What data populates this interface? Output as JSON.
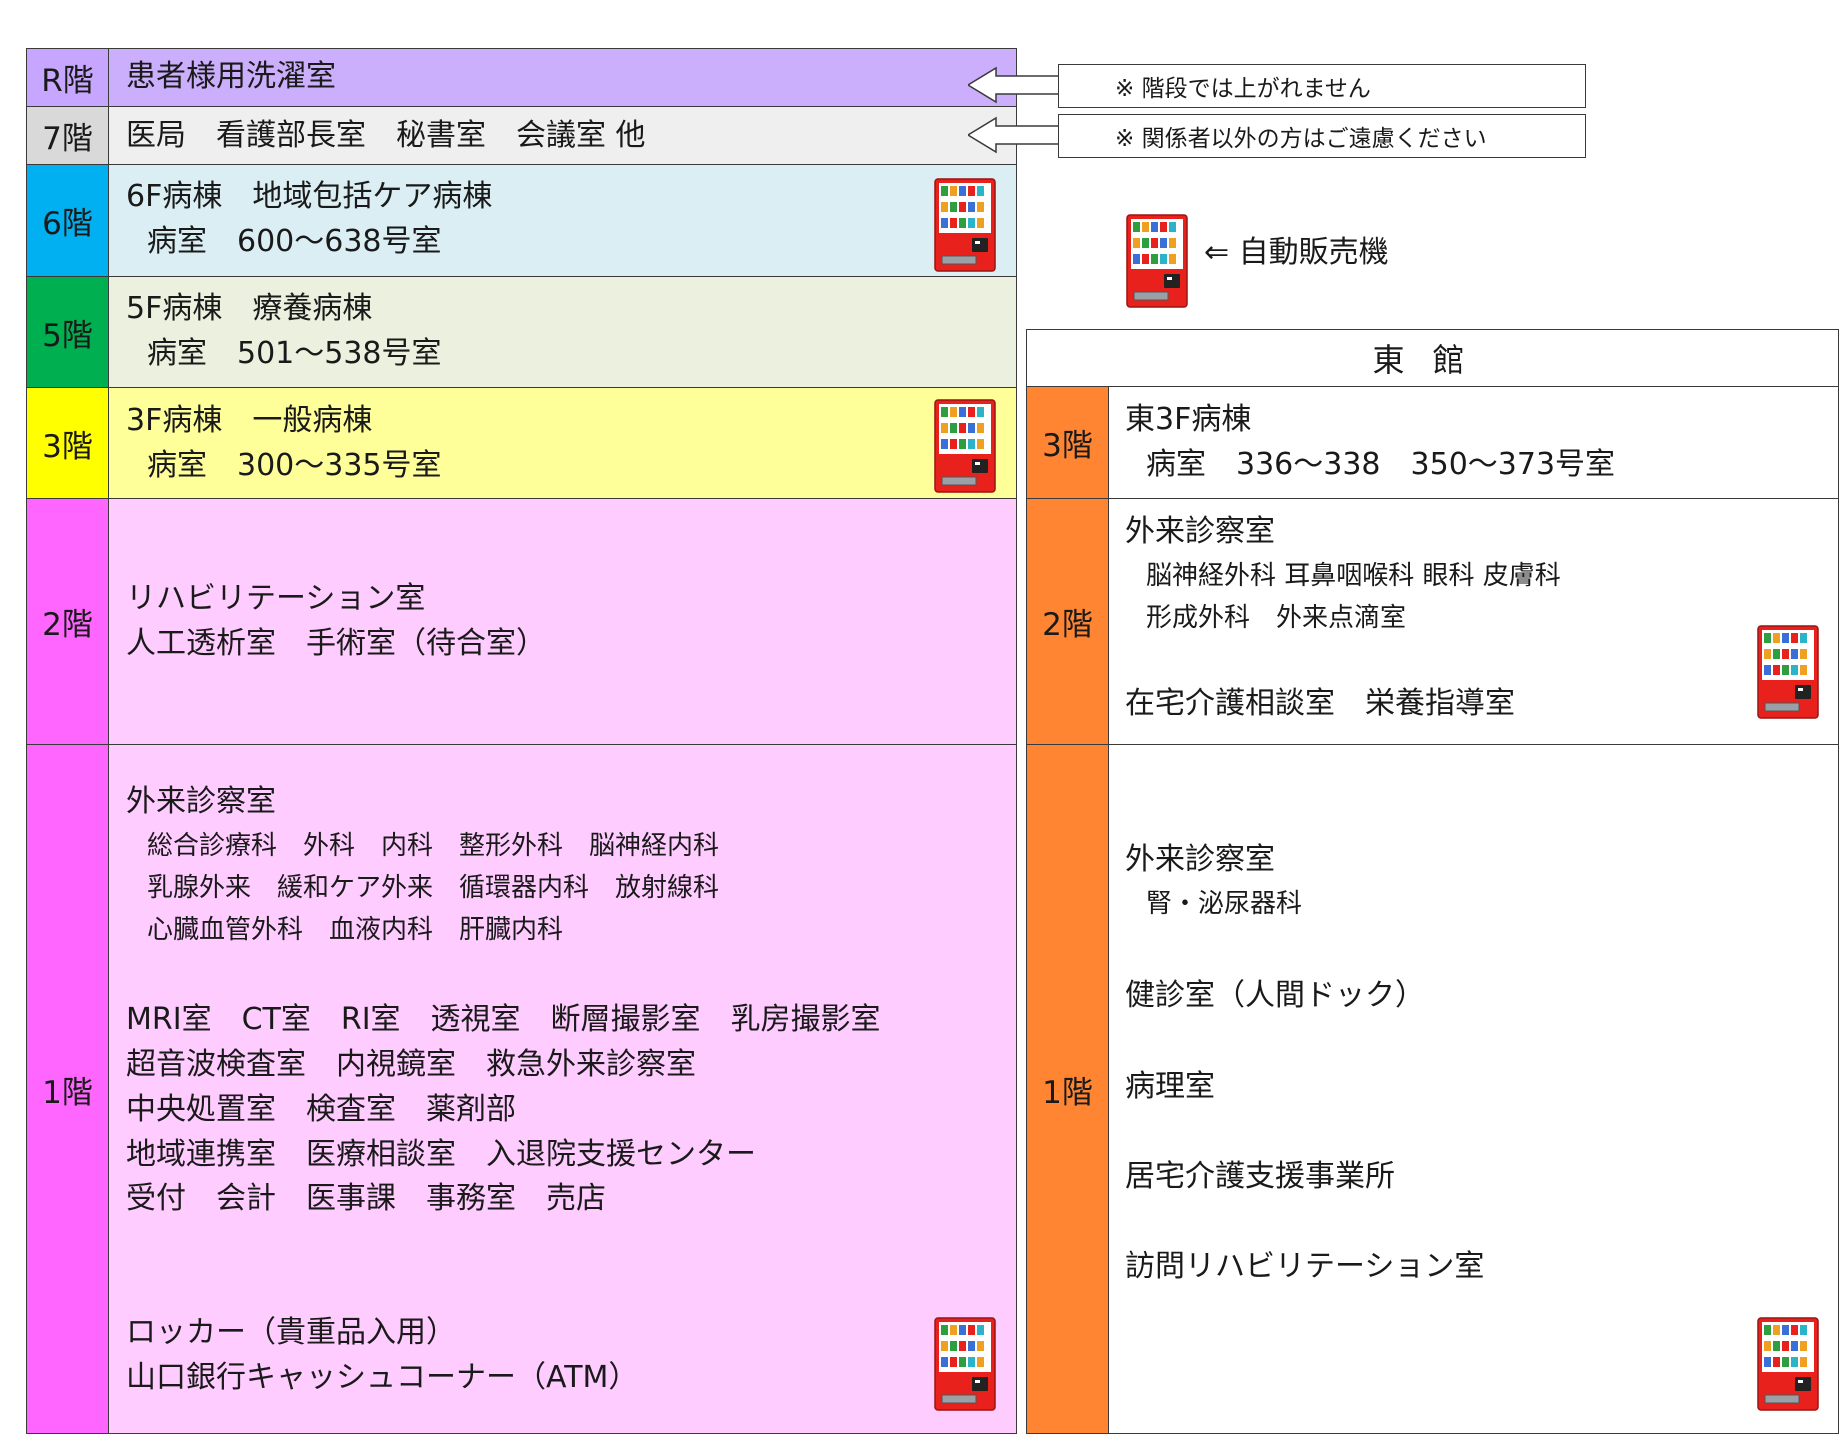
{
  "colors": {
    "R": "#c7a6ff",
    "7": "#d9d9d9",
    "6": "#00b0f0",
    "5": "#00b050",
    "3": "#ffff00",
    "2": "#ff66ff",
    "1": "#ff66ff",
    "east": "#ff8533",
    "content_R": "#cbaefc",
    "content_7": "#efefef",
    "content_6": "#daeef3",
    "content_5": "#ebf1de",
    "content_3": "#ffff99",
    "content_2": "#ffccff",
    "content_1": "#ffccff",
    "content_east": "#ffffff"
  },
  "main": {
    "R": {
      "label": "R階",
      "lines": [
        "患者様用洗濯室"
      ]
    },
    "f7": {
      "label": "7階",
      "lines": [
        "医局　看護部長室　秘書室　会議室 他"
      ]
    },
    "f6": {
      "label": "6階",
      "lines": [
        "6F病棟　地域包括ケア病棟",
        "病室　600～638号室"
      ]
    },
    "f5": {
      "label": "5階",
      "lines": [
        "5F病棟　療養病棟",
        "病室　501～538号室"
      ]
    },
    "f3": {
      "label": "3階",
      "lines": [
        "3F病棟　一般病棟",
        "病室　300～335号室"
      ]
    },
    "f2": {
      "label": "2階",
      "lines": [
        "リハビリテーション室",
        "人工透析室　手術室（待合室）"
      ]
    },
    "f1": {
      "label": "1階",
      "lines": [
        "外来診察室",
        "総合診療科　外科　内科　整形外科　脳神経内科",
        "乳腺外来　緩和ケア外来　循環器内科　放射線科",
        "心臓血管外科　血液内科　肝臓内科",
        "MRI室　CT室　RI室　透視室　断層撮影室　乳房撮影室",
        "超音波検査室　内視鏡室　救急外来診察室",
        "中央処置室　検査室　薬剤部",
        "地域連携室　医療相談室　入退院支援センター",
        "受付　会計　医事課　事務室　売店",
        "ロッカー（貴重品入用）",
        "山口銀行キャッシュコーナー（ATM）"
      ]
    }
  },
  "notes": {
    "stairs": "※ 階段では上がれません",
    "staff_only": "※ 関係者以外の方はご遠慮ください"
  },
  "legend": {
    "vending": "⇐ 自動販売機"
  },
  "east": {
    "title": "東館",
    "f3": {
      "label": "3階",
      "lines": [
        "東3F病棟",
        "病室　336～338　350～373号室"
      ]
    },
    "f2": {
      "label": "2階",
      "lines": [
        "外来診察室",
        "脳神経外科 耳鼻咽喉科 眼科 皮膚科",
        "形成外科　外来点滴室",
        "在宅介護相談室　栄養指導室"
      ]
    },
    "f1": {
      "label": "1階",
      "lines": [
        "外来診察室",
        "腎・泌尿器科",
        "健診室（人間ドック）",
        "病理室",
        "居宅介護支援事業所",
        "訪問リハビリテーション室"
      ]
    }
  }
}
